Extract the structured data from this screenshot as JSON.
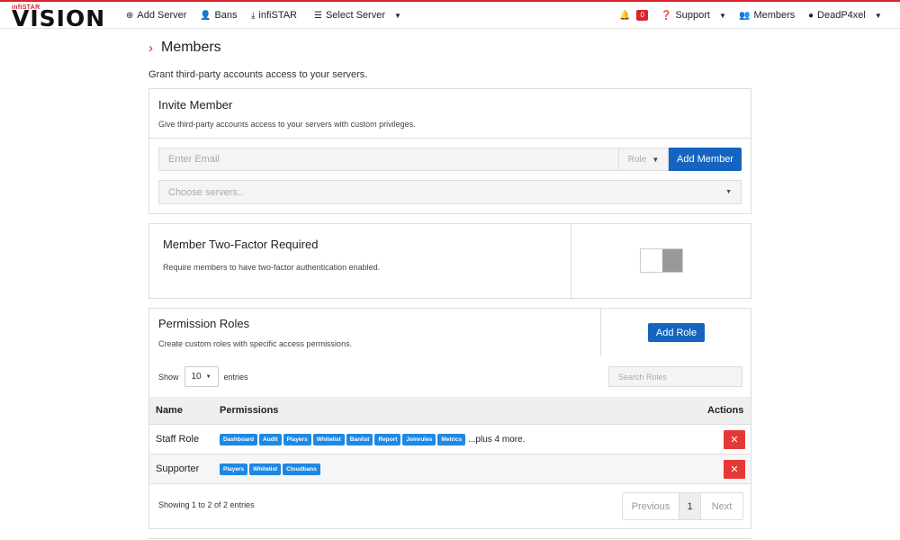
{
  "brand": {
    "small": "infiSTAR",
    "big": "VISION"
  },
  "nav": {
    "add_server": "Add Server",
    "bans": "Bans",
    "infistar": "infiSTAR",
    "select_server": "Select Server",
    "notification_count": "0",
    "support": "Support",
    "members": "Members",
    "user": "DeadP4xel"
  },
  "page": {
    "title": "Members",
    "subtitle": "Grant third-party accounts access to your servers."
  },
  "invite": {
    "title": "Invite Member",
    "description": "Give third-party accounts access to your servers with custom privileges.",
    "email_placeholder": "Enter Email",
    "role_label": "Role",
    "add_member": "Add Member",
    "servers_placeholder": "Choose servers.."
  },
  "twofa": {
    "title": "Member Two-Factor Required",
    "description": "Require members to have two-factor authentication enabled.",
    "enabled": false
  },
  "roles": {
    "title": "Permission Roles",
    "description": "Create custom roles with specific access permissions.",
    "add_role": "Add Role",
    "show_label": "Show",
    "page_length": "10",
    "entries_label": "entries",
    "search_placeholder": "Search Roles",
    "columns": {
      "name": "Name",
      "permissions": "Permissions",
      "actions": "Actions"
    },
    "rows": [
      {
        "name": "Staff Role",
        "permissions": [
          "Dashboard",
          "Audit",
          "Players",
          "Whitelist",
          "Banlist",
          "Report",
          "Joinrules",
          "Metrics"
        ],
        "more": "...plus 4 more."
      },
      {
        "name": "Supporter",
        "permissions": [
          "Players",
          "Whitelist",
          "Cloudbans"
        ],
        "more": ""
      }
    ],
    "delete_symbol": "✕",
    "info": "Showing 1 to 2 of 2 entries",
    "pagination": {
      "previous": "Previous",
      "current": "1",
      "next": "Next"
    }
  },
  "colors": {
    "accent": "#d9232d",
    "primary": "#1565c0",
    "tag": "#1e88e5",
    "danger": "#e53935"
  }
}
